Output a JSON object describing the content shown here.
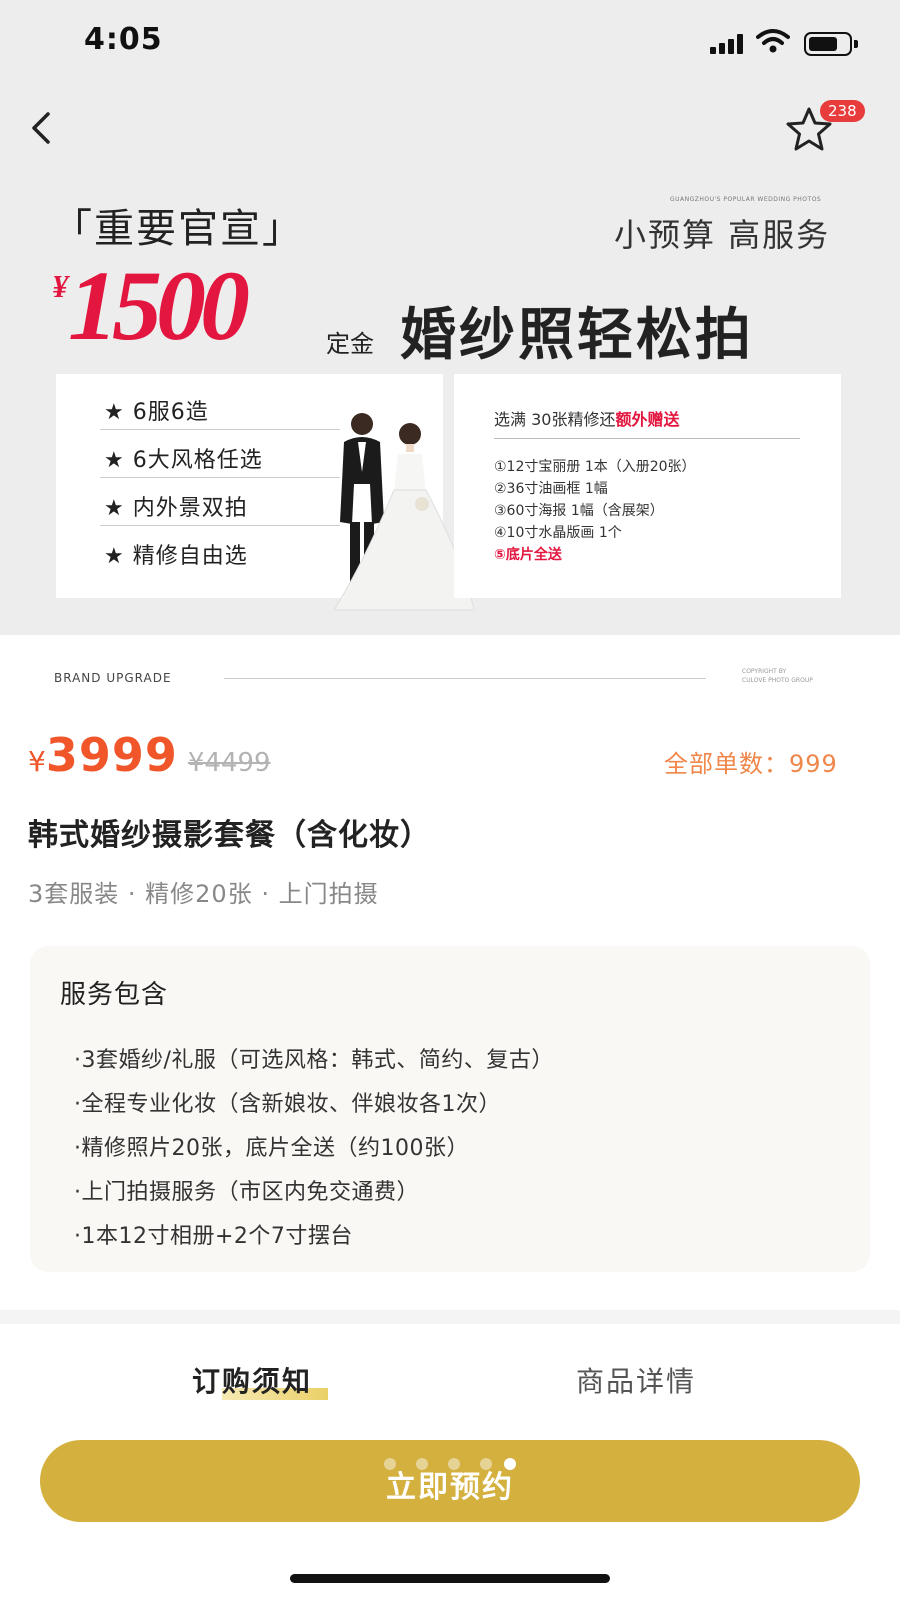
{
  "status_bar": {
    "time": "4:05"
  },
  "header": {
    "favorite_count": "238"
  },
  "banner": {
    "announcement": "「重要官宣」",
    "tiny_caption": "GUANGZHOU'S POPULAR WEDDING PHOTOS",
    "slogan": "小预算 高服务",
    "deposit_currency": "¥",
    "deposit_amount": "1500",
    "deposit_label": "定金",
    "headline": "婚纱照轻松拍",
    "features": [
      "★ 6服6造",
      "★ 6大风格任选",
      "★ 内外景双拍",
      "★ 精修自由选"
    ],
    "bonus_title_prefix": "选满 30张精修还",
    "bonus_title_highlight": "额外赠送",
    "gifts": [
      "①12寸宝丽册 1本（入册20张）",
      "②36寸油画框 1幅",
      "③60寸海报 1幅（含展架）",
      "④10寸水晶版画 1个"
    ],
    "gift_highlight": "⑤底片全送"
  },
  "brand_strip": {
    "left": "BRAND  UPGRADE",
    "right_line1": "COPYRIGHT BY",
    "right_line2": "CULOVE PHOTO GROUP"
  },
  "price": {
    "currency": "¥",
    "current": "3999",
    "original": "¥4499"
  },
  "sold": "全部单数：999",
  "product": {
    "title": "韩式婚纱摄影套餐（含化妆）",
    "subtitle": "3套服装 · 精修20张 · 上门拍摄"
  },
  "services": {
    "title": "服务包含",
    "items": [
      "·3套婚纱/礼服（可选风格：韩式、简约、复古）",
      "·全程专业化妆（含新娘妆、伴娘妆各1次）",
      "·精修照片20张，底片全送（约100张）",
      "·上门拍摄服务（市区内免交通费）",
      "·1本12寸相册+2个7寸摆台"
    ]
  },
  "tabs": {
    "notice": "订购须知",
    "detail": "商品详情"
  },
  "cta": {
    "label": "立即预约"
  },
  "colors": {
    "accent": "#d4b03e",
    "price": "#f0562a",
    "banner_red": "#e2163f"
  }
}
